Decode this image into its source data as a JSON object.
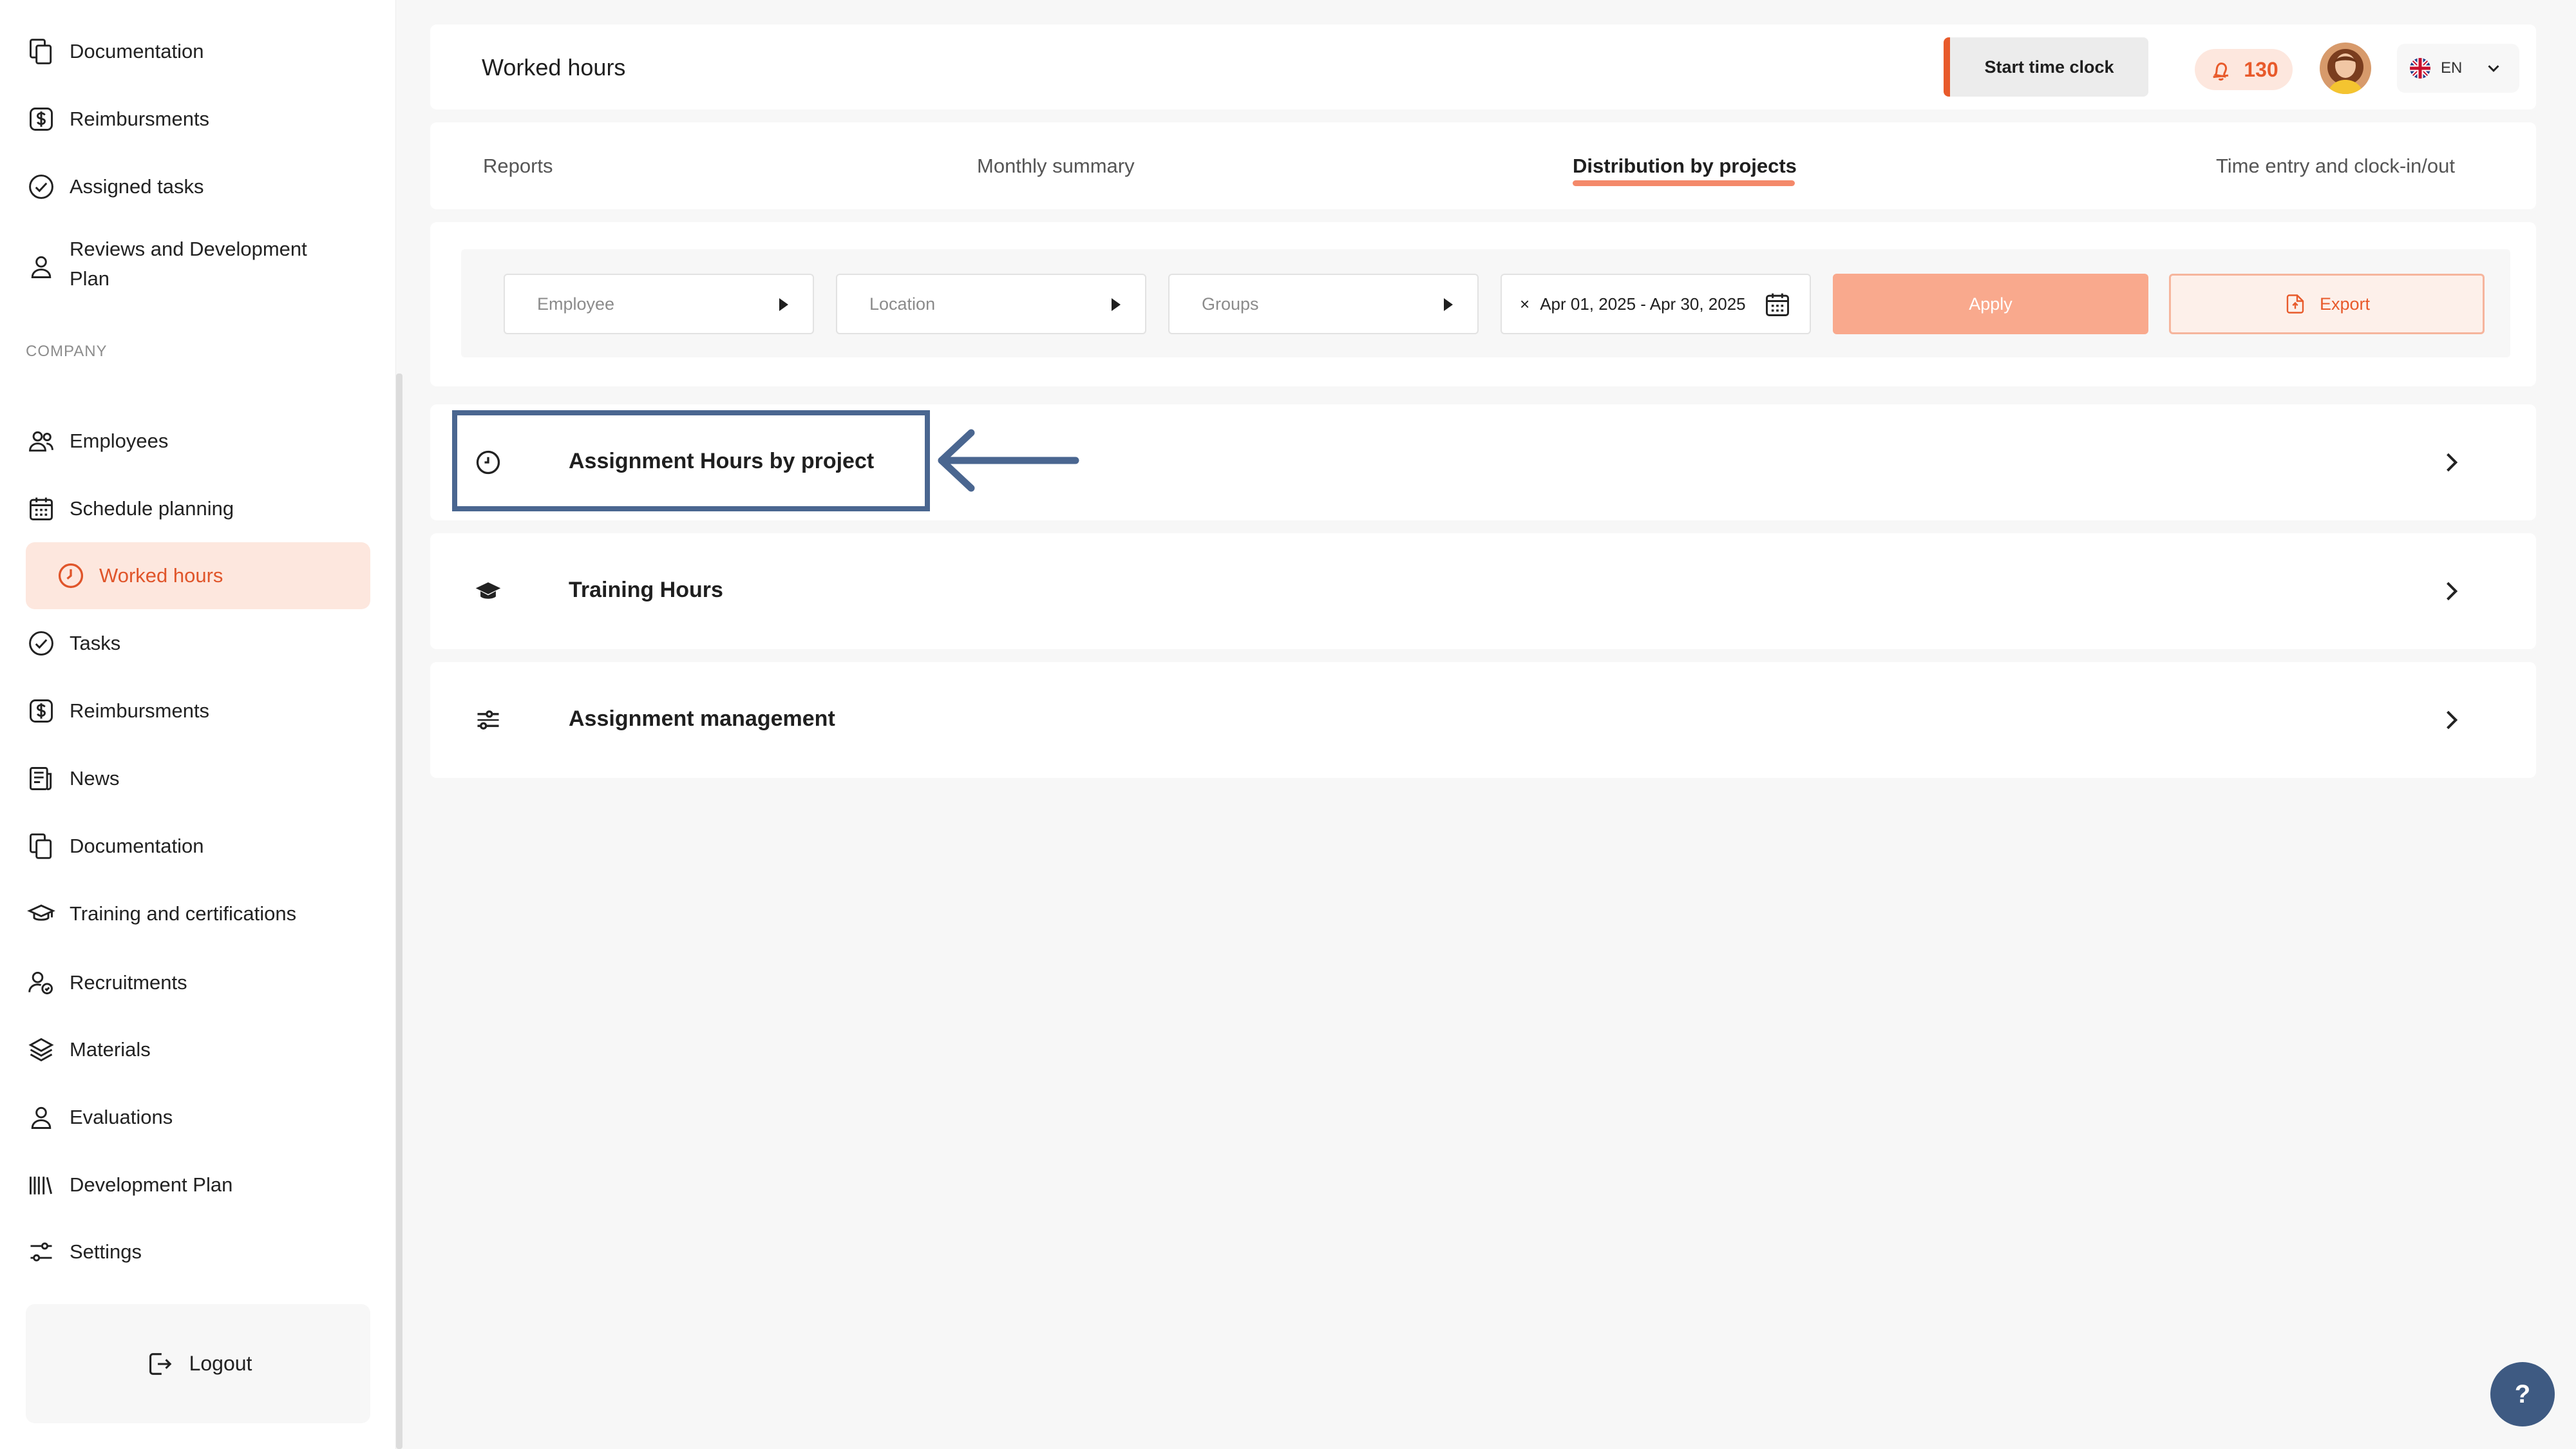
{
  "sidebar": {
    "items_top": [
      {
        "label": "Documentation",
        "icon": "documents-icon"
      },
      {
        "label": "Reimbursments",
        "icon": "dollar-icon"
      },
      {
        "label": "Assigned tasks",
        "icon": "check-circle-icon"
      },
      {
        "label": "Reviews and Development Plan",
        "icon": "person-icon"
      }
    ],
    "section_label": "COMPANY",
    "items_company": [
      {
        "label": "Employees",
        "icon": "people-icon"
      },
      {
        "label": "Schedule planning",
        "icon": "calendar-icon"
      },
      {
        "label": "Worked hours",
        "icon": "clock-icon",
        "active": true
      },
      {
        "label": "Tasks",
        "icon": "check-circle-icon"
      },
      {
        "label": "Reimbursments",
        "icon": "dollar-icon"
      },
      {
        "label": "News",
        "icon": "news-icon"
      },
      {
        "label": "Documentation",
        "icon": "documents-icon"
      },
      {
        "label": "Training and certifications",
        "icon": "graduation-cap-icon"
      },
      {
        "label": "Recruitments",
        "icon": "recruit-icon"
      },
      {
        "label": "Materials",
        "icon": "layers-icon"
      },
      {
        "label": "Evaluations",
        "icon": "person-icon"
      },
      {
        "label": "Development Plan",
        "icon": "books-icon"
      },
      {
        "label": "Settings",
        "icon": "sliders-icon"
      }
    ],
    "logout_label": "Logout"
  },
  "header": {
    "title": "Worked hours",
    "start_clock_label": "Start time clock",
    "notification_count": "130",
    "language": "EN"
  },
  "tabs": [
    {
      "label": "Reports",
      "active": false
    },
    {
      "label": "Monthly summary",
      "active": false
    },
    {
      "label": "Distribution by projects",
      "active": true
    },
    {
      "label": "Time entry and clock-in/out",
      "active": false
    }
  ],
  "filters": {
    "employee_placeholder": "Employee",
    "location_placeholder": "Location",
    "groups_placeholder": "Groups",
    "date_range": "Apr 01, 2025 - Apr 30, 2025",
    "clear_symbol": "×",
    "apply_label": "Apply",
    "export_label": "Export"
  },
  "reports": [
    {
      "label": "Assignment Hours by project",
      "icon": "clock-icon"
    },
    {
      "label": "Training Hours",
      "icon": "graduation-cap-icon"
    },
    {
      "label": "Assignment management",
      "icon": "sliders-icon"
    }
  ],
  "help_label": "?",
  "colors": {
    "accent": "#e85a2b",
    "accent_light": "#fde7de",
    "apply_bg": "#f9a98d",
    "annotation": "#4a6690",
    "help_bg": "#3e5a82"
  }
}
